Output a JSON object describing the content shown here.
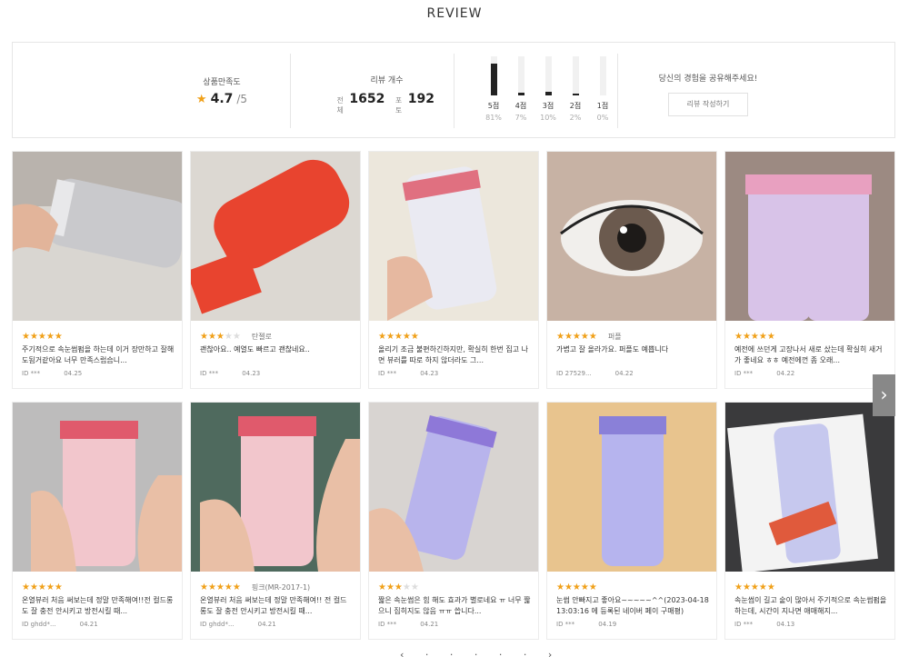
{
  "title": "REVIEW",
  "summary": {
    "satisfaction_label": "상품만족도",
    "rating": "4.7",
    "rating_max": "/5",
    "count_label": "리뷰 개수",
    "total_label": "전체",
    "total_count": "1652",
    "photo_label": "포토",
    "photo_count": "192",
    "distribution": [
      {
        "label": "5점",
        "pct": "81%",
        "value": 0.81
      },
      {
        "label": "4점",
        "pct": "7%",
        "value": 0.07
      },
      {
        "label": "3점",
        "pct": "10%",
        "value": 0.1
      },
      {
        "label": "2점",
        "pct": "2%",
        "value": 0.02
      },
      {
        "label": "1점",
        "pct": "0%",
        "value": 0.0
      }
    ],
    "share_text": "당신의 경험을 공유해주세요!",
    "write_button": "리뷰 작성하기"
  },
  "reviews": [
    {
      "stars": 5,
      "option": "",
      "text": "주기적으로 속눈썹펌을 하는데 이거 장만하고 잘해도됨거같아요 너무 만족스럽습니...",
      "user": "ID ***",
      "date": "04.25",
      "photo": "gray-curler-hand"
    },
    {
      "stars": 3,
      "option": "탄젤로",
      "text": "괜찮아요.. 예열도 빠르고 괜찮네요..",
      "user": "ID ***",
      "date": "04.23",
      "photo": "orange-curler-table"
    },
    {
      "stars": 5,
      "option": "",
      "text": "올리기 조금 불편하긴하지만, 확실히 한번 집고 나면 뷰러를 따로 하지 않더라도 그...",
      "user": "ID ***",
      "date": "04.23",
      "photo": "white-curler-hand"
    },
    {
      "stars": 5,
      "option": "퍼플",
      "text": "가볍고 잘 올라가요. 퍼플도 예쁩니다",
      "user": "ID 27529...",
      "date": "04.22",
      "photo": "eye-closeup"
    },
    {
      "stars": 5,
      "option": "",
      "text": "예전에 쓰던게 고장나서 새로 샀는데 확실히 새거가 좋네요 ㅎㅎ 예전에껀 좀 오래...",
      "user": "ID ***",
      "date": "04.22",
      "photo": "two-lilac-curlers"
    },
    {
      "stars": 5,
      "option": "",
      "text": "온열뷰러 처음 써보는데 정말 만족해여!!전 컬드롱도 잘 충전 안시키고 방전시킬 때...",
      "user": "ID ghdd*...",
      "date": "04.21",
      "photo": "pink-curler-hand"
    },
    {
      "stars": 5,
      "option": "핑크(MR-2017-1)",
      "text": "온열뷰러 처음 써보는데 정말 만족해여!! 전 컬드롱도 잘 충전 안시키고 방전시킬 때...",
      "user": "ID ghdd*...",
      "date": "04.21",
      "photo": "pink-curler-hand-2"
    },
    {
      "stars": 3,
      "option": "",
      "text": "짧은 속눈썹은 힘 해도 효과가 별로네요 ㅠ 너무 짧으니 집히지도 않음 ㅠㅠ 씁니다...",
      "user": "ID ***",
      "date": "04.21",
      "photo": "purple-curler-hand"
    },
    {
      "stars": 5,
      "option": "",
      "text": "눈썹 안빠지고 좋아요~~~~~^^(2023-04-18 13:03:16 에 등록된 네이버 페이 구매평)",
      "user": "ID ***",
      "date": "04.19",
      "photo": "purple-curler-stand"
    },
    {
      "stars": 5,
      "option": "",
      "text": "속눈썹이 길고 숱이 많아서 주기적으로 속눈썹펌을 하는데, 시간이 지나면 애매해지...",
      "user": "ID ***",
      "date": "04.13",
      "photo": "curler-in-box"
    }
  ],
  "next_icon": "chevron-right-icon",
  "pager": "‹ · · · · · ›",
  "colors": {
    "star": "#f0a019",
    "bar": "#222222",
    "border": "#e6e6e6"
  }
}
